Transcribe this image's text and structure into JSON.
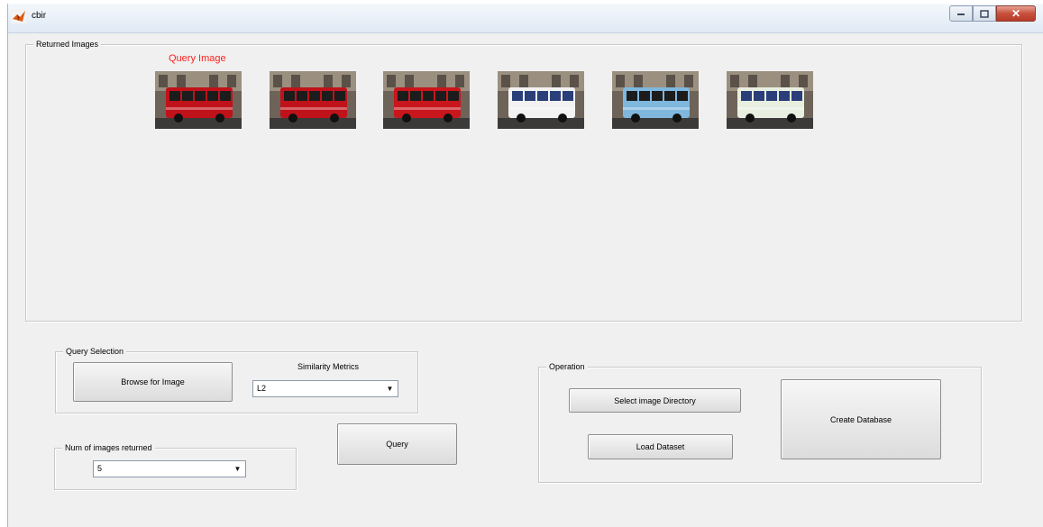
{
  "window": {
    "title": "cbir",
    "controls": [
      "minimize",
      "maximize",
      "close"
    ]
  },
  "returned_images": {
    "legend": "Returned Images",
    "query_label": "Query Image",
    "thumbnails": [
      {
        "bus_color": "#c0121a",
        "name": "query-image"
      },
      {
        "bus_color": "#c0121a",
        "name": "result-1"
      },
      {
        "bus_color": "#c9161c",
        "name": "result-2"
      },
      {
        "bus_color": "#f2f2f2",
        "name": "result-3"
      },
      {
        "bus_color": "#7fb7dd",
        "name": "result-4"
      },
      {
        "bus_color": "#e9efe0",
        "name": "result-5"
      }
    ]
  },
  "query_selection": {
    "legend": "Query Selection",
    "browse_label": "Browse for Image",
    "similarity_label": "Similarity Metrics",
    "similarity_value": "L2"
  },
  "num_images": {
    "legend": "Num of images returned",
    "value": "5"
  },
  "query_button_label": "Query",
  "operation": {
    "legend": "Operation",
    "select_dir_label": "Select image Directory",
    "load_dataset_label": "Load Dataset",
    "create_db_label": "Create Database"
  },
  "colors": {
    "accent_red": "#ff2020",
    "panel_bg": "#f0f0f0"
  }
}
